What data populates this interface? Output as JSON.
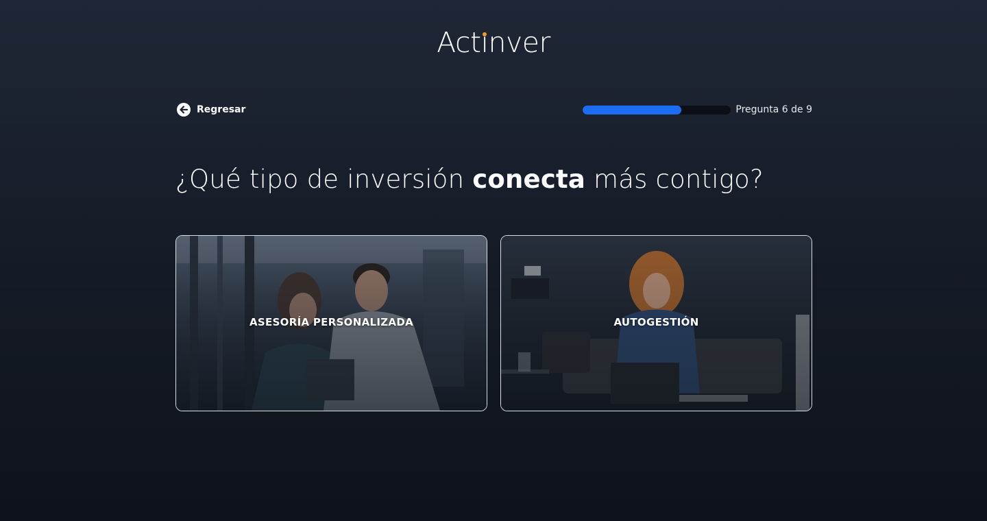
{
  "brand": {
    "logo_pre": "Act",
    "logo_i": "i",
    "logo_post": "nver",
    "accent_dot_color": "#f39c1f"
  },
  "nav": {
    "back_label": "Regresar"
  },
  "progress": {
    "label": "Pregunta 6 de 9",
    "fraction": 0.667,
    "fill_color": "#1b6ef3"
  },
  "question": {
    "pre": "¿Qué tipo de inversión ",
    "bold": "conecta",
    "post": " más contigo?"
  },
  "options": [
    {
      "label": "ASESORÍA PERSONALIZADA",
      "image": "two-professionals-talking-photo"
    },
    {
      "label": "AUTOGESTIÓN",
      "image": "woman-on-laptop-photo"
    }
  ]
}
